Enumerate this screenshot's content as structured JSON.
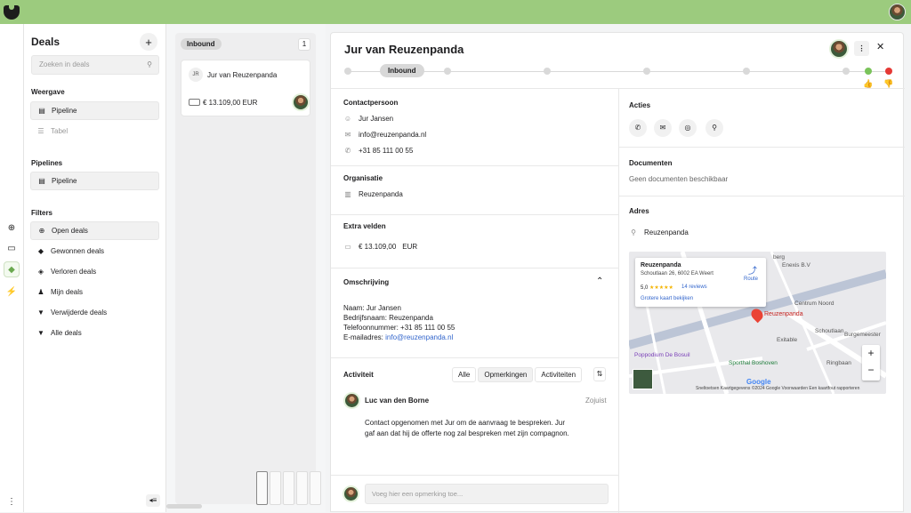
{
  "board": {
    "stage": "Inbound",
    "count": "1",
    "card": {
      "initials": "JR",
      "name": "Jur van Reuzenpanda",
      "amount": "€ 13.109,00 EUR"
    }
  },
  "sidebar": {
    "title": "Deals",
    "search_placeholder": "Zoeken in deals",
    "view_heading": "Weergave",
    "views": [
      "Pipeline",
      "Tabel"
    ],
    "pipelines_heading": "Pipelines",
    "pipelines": [
      "Pipeline"
    ],
    "filters_heading": "Filters",
    "filters": [
      "Open deals",
      "Gewonnen deals",
      "Verloren deals",
      "Mijn deals",
      "Verwijderde deals",
      "Alle deals"
    ]
  },
  "deal": {
    "title": "Jur van Reuzenpanda",
    "stage": "Inbound",
    "contact_heading": "Contactpersoon",
    "contact_name": "Jur Jansen",
    "contact_email": "info@reuzenpanda.nl",
    "contact_phone": "+31 85 111 00 55",
    "org_heading": "Organisatie",
    "org_name": "Reuzenpanda",
    "extra_heading": "Extra velden",
    "extra_amount": "€ 13.109,00",
    "extra_currency": "EUR",
    "desc_heading": "Omschrijving",
    "desc_lines": [
      "Naam: Jur Jansen",
      "Bedrijfsnaam: Reuzenpanda",
      "Telefoonnummer: +31 85 111 00 55"
    ],
    "desc_email_label": "E-mailadres:",
    "desc_email": "info@reuzenpanda.nl",
    "activity_heading": "Activiteit",
    "activity_tabs": [
      "Alle",
      "Opmerkingen",
      "Activiteiten"
    ],
    "activity": {
      "author": "Luc van den Borne",
      "time": "Zojuist",
      "text": "Contact opgenomen met Jur om de aanvraag te bespreken. Jur gaf aan dat hij de offerte nog zal bespreken met zijn compagnon."
    },
    "comment_placeholder": "Voeg hier een opmerking toe...",
    "actions_heading": "Acties",
    "docs_heading": "Documenten",
    "docs_empty": "Geen documenten beschikbaar",
    "address_heading": "Adres",
    "address_name": "Reuzenpanda"
  },
  "map": {
    "place": "Reuzenpanda",
    "address": "Schoutlaan 26, 6002 EA Weert",
    "rating": "5,0",
    "stars": "★★★★★",
    "reviews": "14 reviews",
    "route": "Route",
    "bigger": "Grotere kaart bekijken",
    "labels": [
      "Enexis B.V",
      "Centrum Noord",
      "Exitable",
      "Poppodium De Bosuil",
      "Sporthal Boshoven",
      "Burgemeester",
      "Schoutlaan",
      "Ringbaan",
      "berg"
    ],
    "footer": "Sneltoetsen   Kaartgegevens ©2024 Google   Voorwaarden   Een kaartfout rapporteren",
    "google": "Google"
  }
}
